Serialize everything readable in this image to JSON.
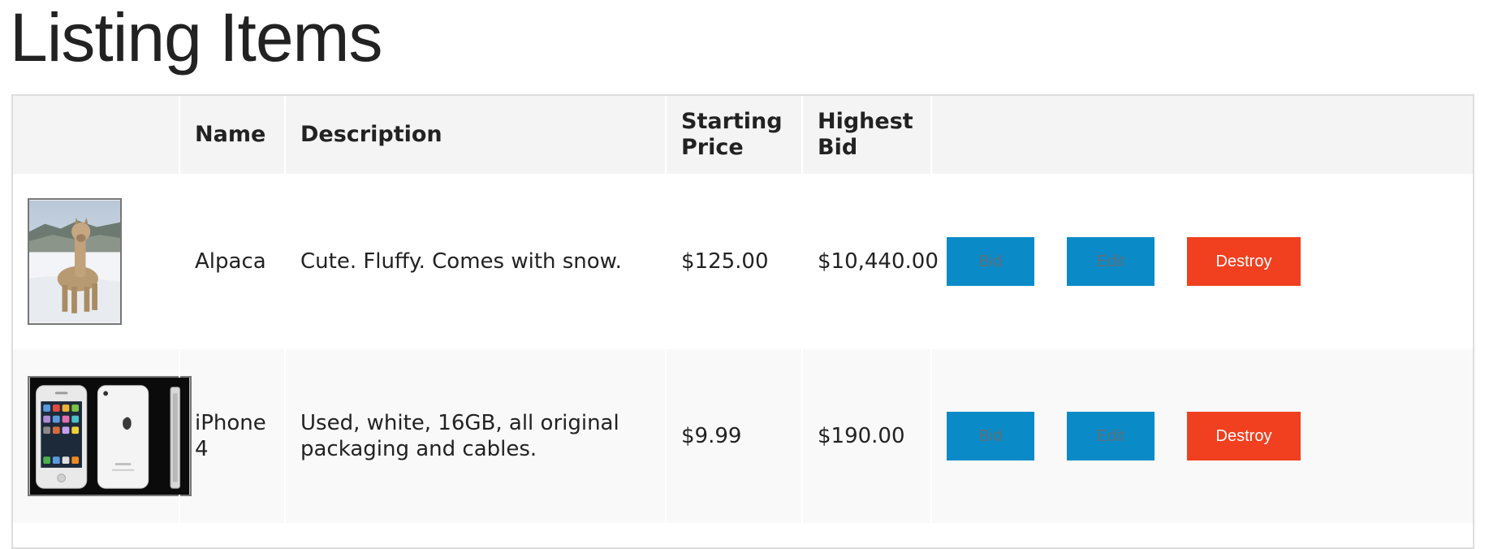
{
  "page": {
    "title": "Listing Items"
  },
  "table": {
    "headers": {
      "image": "",
      "name": "Name",
      "description": "Description",
      "starting_price_line1": "Starting",
      "starting_price_line2": "Price",
      "highest_bid_line1": "Highest",
      "highest_bid_line2": "Bid",
      "actions": ""
    },
    "rows": [
      {
        "name": "Alpaca",
        "description": "Cute. Fluffy. Comes with snow.",
        "starting_price": "$125.00",
        "highest_bid": "$10,440.00",
        "image_icon": "alpaca-photo",
        "bid_label": "Bid",
        "edit_label": "Edit",
        "destroy_label": "Destroy"
      },
      {
        "name": "iPhone 4",
        "description_line1": "Used, white, 16GB, all original",
        "description_line2": "packaging and cables.",
        "starting_price": "$9.99",
        "highest_bid": "$190.00",
        "image_icon": "iphone-photo",
        "bid_label": "Bid",
        "edit_label": "Edit",
        "destroy_label": "Destroy"
      }
    ]
  },
  "colors": {
    "action_blue": "#0a8bc7",
    "destroy_red": "#f0401f",
    "header_bg": "#f4f4f4",
    "row_alt_bg": "#f9f9f9"
  }
}
